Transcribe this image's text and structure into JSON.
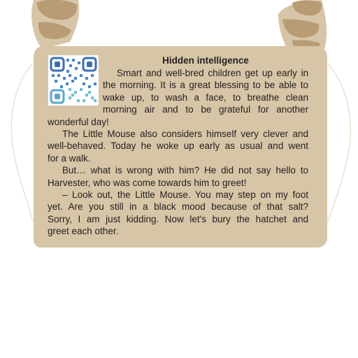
{
  "colors": {
    "card": "#d6c5a6",
    "card_dark": "#bda97f",
    "stone": "#b89c76",
    "text": "#231f20",
    "qr_blue": "#3a6fb5",
    "qr_teal": "#6cc0d6"
  },
  "page": {
    "title": "Hidden intelligence",
    "paragraphs": [
      [
        "Smart and well-bred children get up early in",
        "the morning. It is a great blessing to be able to",
        "wake up, to wash a face, to breathe clean",
        "morning air and to be grateful for another",
        "wonderful day!"
      ],
      [
        "The Little Mouse also considers himself very clever and",
        "well-behaved. Today he woke up early as usual and went",
        "for a walk."
      ],
      [
        "But… what is wrong with him? He did not say hello to",
        "Harvester, who was come towards him to greet!"
      ],
      [
        "– Look out, the Little Mouse. You may step on my foot",
        "yet. Are you still in a black mood because of that salt?",
        "Sorry, I am just kidding. Now let's bury the hatchet and",
        "greet each other."
      ]
    ]
  },
  "qr_code": {
    "icon": "qr-code-icon"
  }
}
